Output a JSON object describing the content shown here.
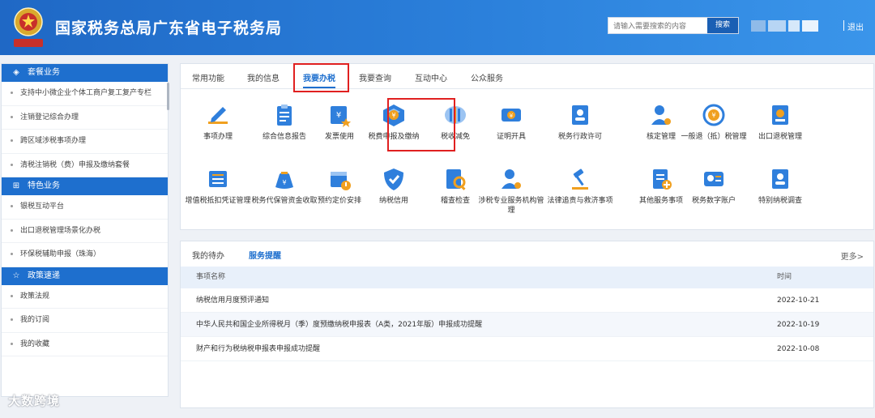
{
  "header": {
    "site_title": "国家税务总局广东省电子税务局",
    "emblem_caption": "中国税务",
    "search_placeholder": "请输入需要搜索的内容",
    "search_button": "搜索",
    "logout": "退出",
    "divider": "|"
  },
  "sidebar": {
    "sections": [
      {
        "title": "套餐业务",
        "icon": "layers-icon",
        "items": [
          "支持中小微企业个体工商户复工复产专栏",
          "注销登记综合办理",
          "跨区域涉税事项办理",
          "清税注销税（费）申报及缴纳套餐"
        ]
      },
      {
        "title": "特色业务",
        "icon": "grid-icon",
        "items": [
          "银税互动平台",
          "出口退税管理场景化办税",
          "环保税辅助申报（珠海）"
        ]
      },
      {
        "title": "政策速递",
        "icon": "star-icon",
        "items": [
          "政策法规",
          "我的订阅",
          "我的收藏"
        ]
      }
    ]
  },
  "main_tabs": [
    "常用功能",
    "我的信息",
    "我要办税",
    "我要查询",
    "互动中心",
    "公众服务"
  ],
  "active_tab": "我要办税",
  "services_row1": [
    {
      "label": "事项办理",
      "icon": "pen-icon"
    },
    {
      "label": "综合信息报告",
      "icon": "clipboard-icon"
    },
    {
      "label": "发票使用",
      "icon": "invoice-icon"
    },
    {
      "label": "税费申报及缴纳",
      "icon": "tax-declare-icon"
    },
    {
      "label": "税收减免",
      "icon": "coins-icon"
    },
    {
      "label": "证明开具",
      "icon": "ticket-icon"
    },
    {
      "label": "税务行政许可",
      "icon": "id-card-icon"
    },
    {
      "label": "核定管理",
      "icon": "user-gear-icon"
    },
    {
      "label": "一般退（抵）税管理",
      "icon": "refund-icon"
    },
    {
      "label": "出口退税管理",
      "icon": "export-refund-icon"
    }
  ],
  "services_row2": [
    {
      "label": "增值税抵扣凭证管理",
      "icon": "vat-icon"
    },
    {
      "label": "税务代保管资金收取",
      "icon": "money-bag-icon"
    },
    {
      "label": "预约定价安排",
      "icon": "calendar-icon"
    },
    {
      "label": "纳税信用",
      "icon": "shield-check-icon"
    },
    {
      "label": "稽查检查",
      "icon": "inspect-icon"
    },
    {
      "label": "涉税专业服务机构管理",
      "icon": "agency-icon"
    },
    {
      "label": "法律追责与救济事项",
      "icon": "gavel-icon"
    },
    {
      "label": "其他服务事项",
      "icon": "doc-plus-icon"
    },
    {
      "label": "税务数字账户",
      "icon": "account-icon"
    },
    {
      "label": "特别纳税调查",
      "icon": "investigation-icon"
    }
  ],
  "todo": {
    "tab_pending": "我的待办",
    "tab_reminder": "服务提醒",
    "more": "更多>",
    "col_name": "事项名称",
    "col_time": "时间",
    "rows": [
      {
        "name": "纳税信用月度预评通知",
        "time": "2022-10-21"
      },
      {
        "name": "中华人民共和国企业所得税月（季）度预缴纳税申报表（A类，2021年版）申报成功提醒",
        "time": "2022-10-19"
      },
      {
        "name": "财产和行为税纳税申报表申报成功提醒",
        "time": "2022-10-08"
      }
    ]
  },
  "watermark": "大数跨境",
  "colors": {
    "brand_blue": "#1e6fce",
    "highlight_red": "#e02020",
    "icon_blue": "#2f7fdc",
    "icon_orange": "#f0a020"
  }
}
